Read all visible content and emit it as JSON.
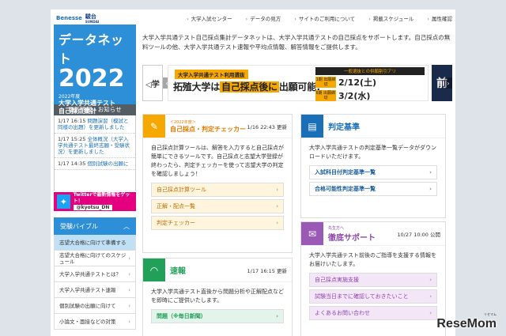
{
  "logos": {
    "benesse": "Benesse",
    "sundai_top": "駿台",
    "sundai_bottom": "SUNDAI"
  },
  "hero": {
    "title": "データネット",
    "year": "2022",
    "sub": "2022年度",
    "line1": "大学入学共通テスト",
    "line2": "自己採点集計"
  },
  "news": {
    "heading": "更新情報・お知らせ",
    "items": [
      {
        "time": "1/17 16:15",
        "text": "問題演習（模試と同様の出題）を更新しました"
      },
      {
        "time": "1/17 15:25",
        "text": "全体概況（大学入学共通テスト最終志願・受験状況）を更新しました"
      },
      {
        "time": "1/17 14:35",
        "text": "個別試験の出願に"
      }
    ]
  },
  "twitter": {
    "line1": "Twitterで最新情報をゲット！",
    "handle": "@kyotsu_DN"
  },
  "nav": {
    "heading": "受験バイブル",
    "items": [
      {
        "label": "志望大合格に向けて準備する",
        "active": true
      },
      {
        "label": "志望大合格に向けてのスケジュール",
        "active": false
      },
      {
        "label": "大学入学共通テストとは？",
        "active": false
      },
      {
        "label": "大学入学共通テスト速報",
        "active": false
      },
      {
        "label": "個別試験の出願に向けて",
        "active": false
      },
      {
        "label": "小論文・面接などの対策",
        "active": false
      }
    ]
  },
  "toplinks": [
    "大学入試センター",
    "データの見方",
    "サイトのご利用について",
    "掲載スケジュール",
    "属性確認"
  ],
  "intro": "大学入学共通テスト自己採点集計データネットは、大学入学共通テストの自己採点をサポートします。自己採点の無料ツールの他、大学入学共通テスト速報や平均点情報、解答情報をご提供します。",
  "banner": {
    "left": "◁学",
    "label": "大学入学共通テスト利用選抜",
    "title_pre": "拓殖大学は",
    "title_em": "自己採点後に",
    "title_post": "出願可能!",
    "sub": "一般選抜との併願割引アリ",
    "rows": [
      {
        "cap": "1期 出願締切",
        "date": "2/12(土)"
      },
      {
        "cap": "Ⅱ期 出願締切",
        "date": "3/2(水)"
      }
    ],
    "next": "前"
  },
  "cards": {
    "self": {
      "small": "＜2022年度＞",
      "title": "自己採点・判定チェッカー",
      "date": "1/16 22:43 更新",
      "body": "自己採点計算ツールは、解答を入力すると自己採点が簡単にできるツールです。自己採点と志望大学登録が終わったら、判定チェッカーを使って志望大学の判定を確認しましょう！",
      "links": [
        "自己採点計算ツール",
        "正解・配点一覧",
        "判定チェッカー"
      ]
    },
    "judge": {
      "title": "判定基準",
      "body": "大学入学共通テストの判定基準一覧データがダウンロードいただけます。",
      "links": [
        "入試科目付判定基準一覧",
        "合格可能性判定基準一覧"
      ]
    },
    "flash": {
      "title": "速報",
      "date": "1/17 16:15 更新",
      "body": "大学入学共通テスト直後から問題分析や正解配点などを即時にご提供いたします。",
      "links": [
        "問題（※毎日新聞）"
      ]
    },
    "support": {
      "small": "先生方へ",
      "title": "徹底サポート",
      "date": "10/27 10:00 公開",
      "body": "大学入学共通テスト前後のご指導を支援する情報をお届けいたします。",
      "links": [
        "自己採点実施支援",
        "試験当日までに確認しておきたいこと",
        "よくあるお問い合わせ"
      ]
    }
  },
  "watermark": {
    "brand": "ReseMom",
    "tag": "リセマム"
  },
  "colors": {
    "blue": "#2d8fd7",
    "orange": "#f6a800",
    "green": "#21a05a",
    "purple": "#9b59b6",
    "pink": "#e4007f"
  }
}
